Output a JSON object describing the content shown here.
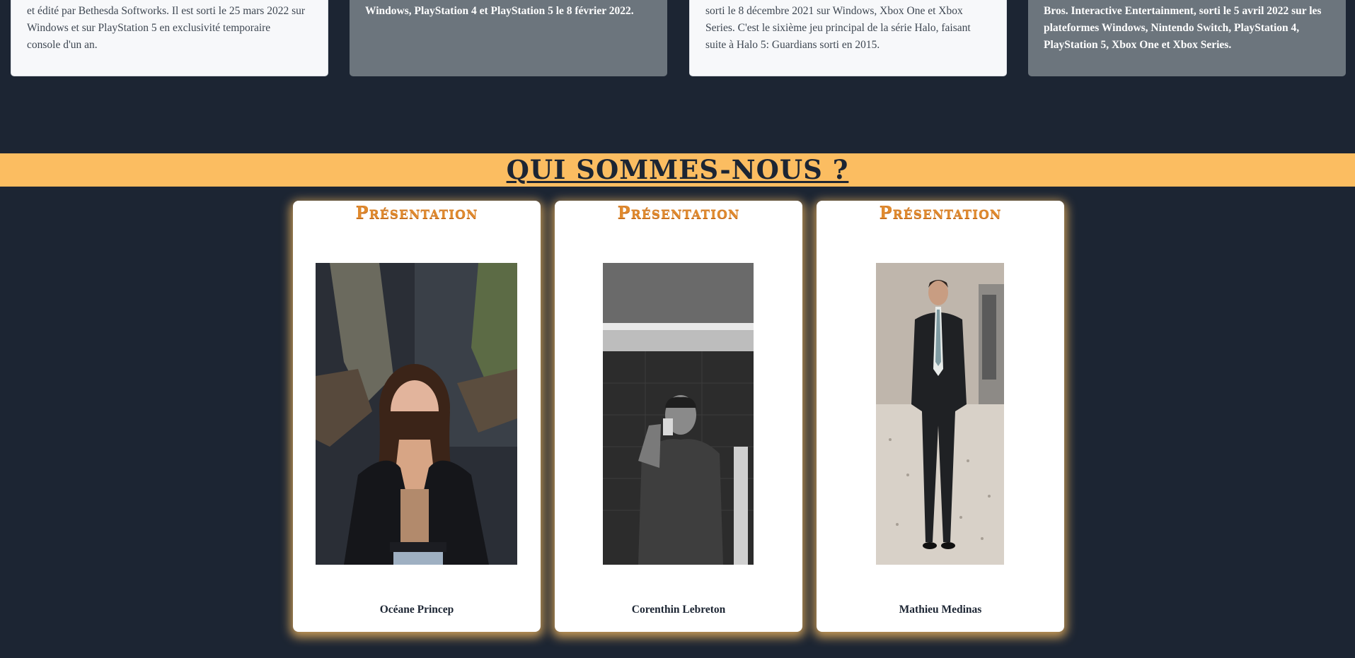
{
  "games": [
    {
      "style": "light",
      "lines": [
        "et édité par Bethesda Softworks. Il est sorti le 25 mars 2022 sur",
        "Windows et sur PlayStation 5 en exclusivité temporaire",
        "console d'un an."
      ]
    },
    {
      "style": "dark",
      "lines": [
        "Windows, PlayStation 4 et PlayStation 5 le 8 février 2022."
      ]
    },
    {
      "style": "light",
      "lines": [
        "sorti le 8 décembre 2021 sur Windows, Xbox One et Xbox",
        "Series. C'est le sixième jeu principal de la série Halo, faisant",
        "suite à Halo 5: Guardians sorti en 2015."
      ]
    },
    {
      "style": "dark",
      "lines": [
        "Bros. Interactive Entertainment, sorti le 5 avril 2022 sur les",
        "plateformes Windows, Nintendo Switch, PlayStation 4,",
        "PlayStation 5, Xbox One et Xbox Series."
      ]
    }
  ],
  "about": {
    "title": "QUI SOMMES-NOUS ?"
  },
  "team": [
    {
      "heading": "Présentation",
      "name": "Océane Princep",
      "photo_icon": "portrait-photo"
    },
    {
      "heading": "Présentation",
      "name": "Corenthin Lebreton",
      "photo_icon": "portrait-photo"
    },
    {
      "heading": "Présentation",
      "name": "Mathieu Medinas",
      "photo_icon": "portrait-photo"
    }
  ],
  "colors": {
    "background": "#1c2533",
    "banner": "#fbbd61",
    "heading_accent": "#e08a2e",
    "card_dark": "#6c757d",
    "card_light": "#f7f8fa"
  }
}
